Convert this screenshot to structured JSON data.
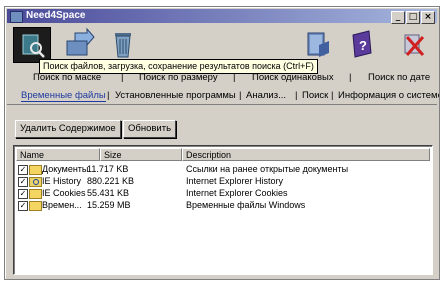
{
  "window": {
    "title": "Need4Space",
    "controls": [
      "_",
      "□",
      "×"
    ]
  },
  "toolbar": {
    "tools": [
      {
        "icon": "search-icon",
        "active": true
      },
      {
        "icon": "folder-arrow-icon"
      },
      {
        "icon": "trash-icon"
      },
      {
        "icon": "book-icon"
      },
      {
        "icon": "help-icon"
      },
      {
        "icon": "exit-icon"
      }
    ],
    "tooltip": "Поиск файлов, загрузка, сохранение результатов поиска (Ctrl+F)"
  },
  "search_tabs": [
    "Поиск по маске",
    "Поиск по размеру",
    "Поиск одинаковых",
    "Поиск по дате"
  ],
  "main_tabs": [
    "Временные файлы",
    "Установленные программы",
    "Анализ...",
    "Поиск",
    "Информация о системе"
  ],
  "buttons": {
    "delete_label": "Удалить Содержимое",
    "refresh_label": "Обновить"
  },
  "table": {
    "columns": [
      "Name",
      "Size",
      "Description"
    ],
    "rows": [
      {
        "checked": true,
        "icon": "folder-icon",
        "name": "Документы",
        "size": "11.717 KB",
        "description": "Ссылки на ранее открытые документы"
      },
      {
        "checked": true,
        "icon": "ie-history-icon",
        "name": "IE History",
        "size": "880.221 KB",
        "description": "Internet Explorer History"
      },
      {
        "checked": true,
        "icon": "folder-icon",
        "name": "IE Cookies",
        "size": "55.431 KB",
        "description": "Internet Explorer Cookies"
      },
      {
        "checked": true,
        "icon": "folder-icon",
        "name": "Времен...",
        "size": "15.259 MB",
        "description": "Временные файлы Windows"
      }
    ]
  }
}
